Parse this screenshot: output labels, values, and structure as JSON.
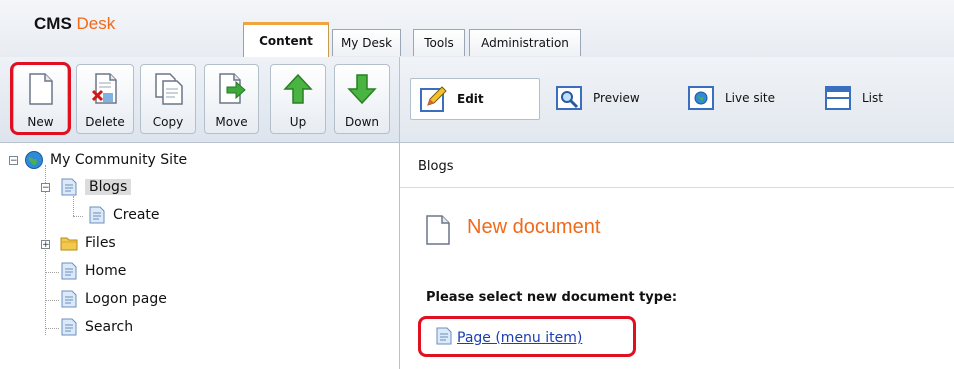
{
  "app": {
    "name_part1": "CMS",
    "name_part2": "Desk"
  },
  "tabs": [
    {
      "label": "Content",
      "active": true
    },
    {
      "label": "My Desk",
      "active": false
    },
    {
      "label": "Tools",
      "active": false
    },
    {
      "label": "Administration",
      "active": false
    }
  ],
  "toolbar": {
    "new": "New",
    "delete": "Delete",
    "copy": "Copy",
    "move": "Move",
    "up": "Up",
    "down": "Down"
  },
  "modes": {
    "edit": "Edit",
    "preview": "Preview",
    "live_site": "Live site",
    "list": "List"
  },
  "tree": {
    "root": "My Community Site",
    "items": [
      {
        "label": "Blogs",
        "selected": true
      },
      {
        "label": "Create"
      },
      {
        "label": "Files"
      },
      {
        "label": "Home"
      },
      {
        "label": "Logon page"
      },
      {
        "label": "Search"
      }
    ]
  },
  "content": {
    "breadcrumb": "Blogs",
    "title": "New document",
    "section_label": "Please select new document type:",
    "doc_type_link": "Page (menu item)"
  },
  "colors": {
    "accent": "#f06a1a",
    "highlight": "#e01020",
    "link": "#1a3fb3"
  }
}
